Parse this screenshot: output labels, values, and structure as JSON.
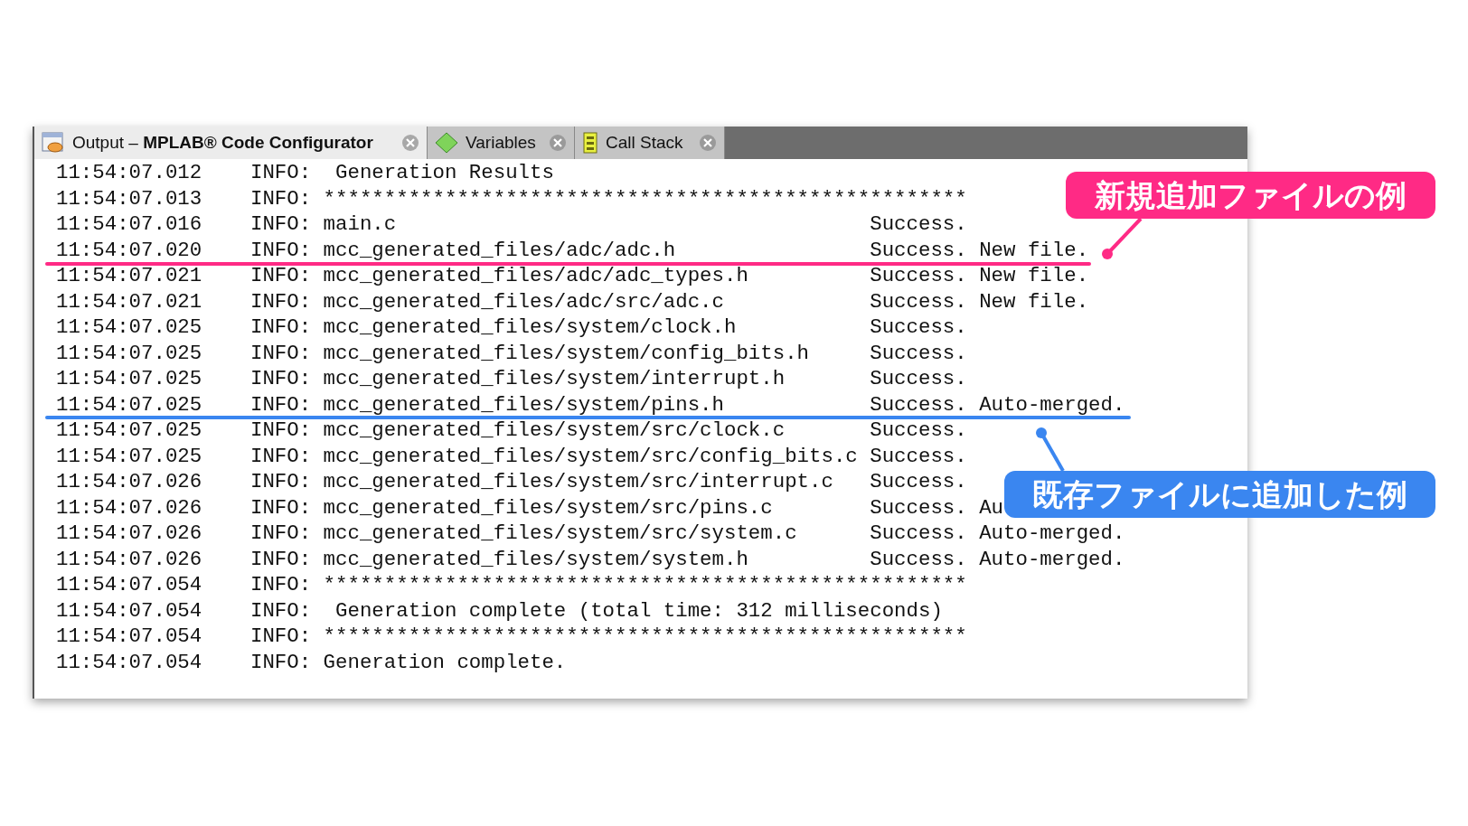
{
  "tabs": [
    {
      "label_plain": "Output – ",
      "label_bold": "MPLAB® Code Configurator",
      "selected": true
    },
    {
      "label_plain": "Variables",
      "selected": false
    },
    {
      "label_plain": "Call Stack",
      "selected": false
    }
  ],
  "log": [
    {
      "time": "11:54:07.012",
      "level": "INFO:",
      "message": " Generation Results"
    },
    {
      "time": "11:54:07.013",
      "level": "INFO:",
      "message": "*****************************************************"
    },
    {
      "time": "11:54:07.016",
      "level": "INFO:",
      "message": "main.c",
      "status": "Success."
    },
    {
      "time": "11:54:07.020",
      "level": "INFO:",
      "message": "mcc_generated_files/adc/adc.h",
      "status": "Success. New file."
    },
    {
      "time": "11:54:07.021",
      "level": "INFO:",
      "message": "mcc_generated_files/adc/adc_types.h",
      "status": "Success. New file."
    },
    {
      "time": "11:54:07.021",
      "level": "INFO:",
      "message": "mcc_generated_files/adc/src/adc.c",
      "status": "Success. New file."
    },
    {
      "time": "11:54:07.025",
      "level": "INFO:",
      "message": "mcc_generated_files/system/clock.h",
      "status": "Success."
    },
    {
      "time": "11:54:07.025",
      "level": "INFO:",
      "message": "mcc_generated_files/system/config_bits.h",
      "status": "Success."
    },
    {
      "time": "11:54:07.025",
      "level": "INFO:",
      "message": "mcc_generated_files/system/interrupt.h",
      "status": "Success."
    },
    {
      "time": "11:54:07.025",
      "level": "INFO:",
      "message": "mcc_generated_files/system/pins.h",
      "status": "Success. Auto-merged."
    },
    {
      "time": "11:54:07.025",
      "level": "INFO:",
      "message": "mcc_generated_files/system/src/clock.c",
      "status": "Success."
    },
    {
      "time": "11:54:07.025",
      "level": "INFO:",
      "message": "mcc_generated_files/system/src/config_bits.c",
      "status": "Success."
    },
    {
      "time": "11:54:07.026",
      "level": "INFO:",
      "message": "mcc_generated_files/system/src/interrupt.c",
      "status": "Success."
    },
    {
      "time": "11:54:07.026",
      "level": "INFO:",
      "message": "mcc_generated_files/system/src/pins.c",
      "status": "Success. Au"
    },
    {
      "time": "11:54:07.026",
      "level": "INFO:",
      "message": "mcc_generated_files/system/src/system.c",
      "status": "Success. Auto-merged."
    },
    {
      "time": "11:54:07.026",
      "level": "INFO:",
      "message": "mcc_generated_files/system/system.h",
      "status": "Success. Auto-merged."
    },
    {
      "time": "11:54:07.054",
      "level": "INFO:",
      "message": "*****************************************************"
    },
    {
      "time": "11:54:07.054",
      "level": "INFO:",
      "message": " Generation complete (total time: 312 milliseconds)"
    },
    {
      "time": "11:54:07.054",
      "level": "INFO:",
      "message": "*****************************************************"
    },
    {
      "time": "11:54:07.054",
      "level": "INFO:",
      "message": "Generation complete."
    }
  ],
  "annotations": [
    {
      "kind": "new-file",
      "text": "新規追加ファイルの例",
      "color": "#ff2a85"
    },
    {
      "kind": "merged",
      "text": "既存ファイルに追加した例",
      "color": "#3a86f0"
    }
  ]
}
